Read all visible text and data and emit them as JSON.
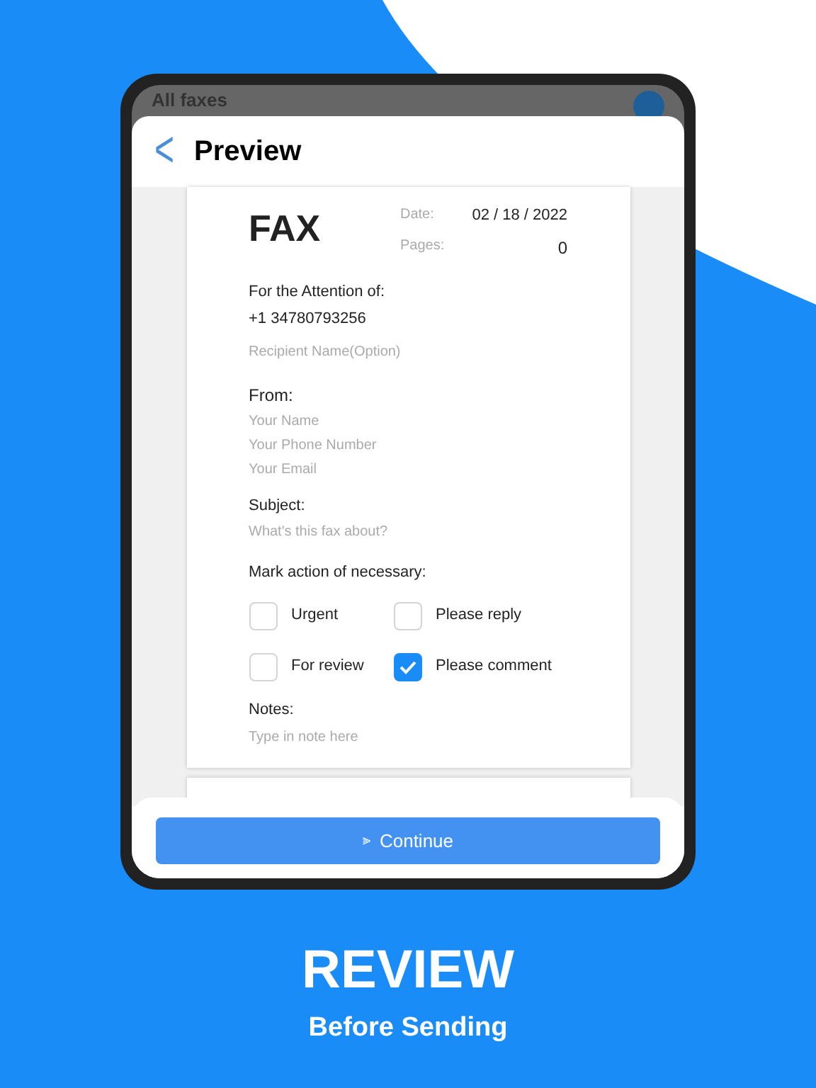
{
  "background_screen": {
    "title": "All faxes"
  },
  "header": {
    "back": "<",
    "title": "Preview"
  },
  "fax": {
    "title": "FAX",
    "date_label": "Date:",
    "date": "02 / 18 / 2022",
    "pages_label": "Pages:",
    "pages": "0",
    "attention_label": "For the Attention of:",
    "number": "+1 34780793256",
    "recipient_placeholder": "Recipient Name(Option)",
    "from_label": "From:",
    "from_placeholders": [
      "Your Name",
      "Your Phone Number",
      "Your Email"
    ],
    "subject_label": "Subject:",
    "subject_placeholder": "What's this fax about?",
    "actions_label": "Mark action of necessary:",
    "actions": [
      {
        "label": "Urgent",
        "checked": false
      },
      {
        "label": "Please reply",
        "checked": false
      },
      {
        "label": "For review",
        "checked": false
      },
      {
        "label": "Please comment",
        "checked": true
      }
    ],
    "notes_label": "Notes:",
    "notes_placeholder": "Type in note here"
  },
  "continue_button": {
    "icon": "⫸",
    "label": "Continue"
  },
  "caption": {
    "headline": "REVIEW",
    "subline": "Before Sending"
  }
}
